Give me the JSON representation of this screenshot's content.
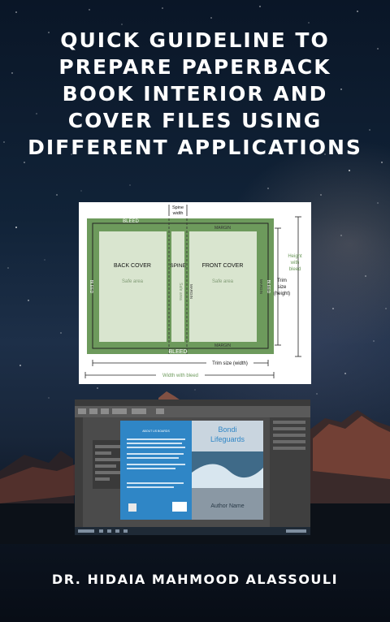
{
  "title": "QUICK GUIDELINE TO PREPARE PAPERBACK BOOK INTERIOR AND COVER FILES USING DIFFERENT APPLICATIONS",
  "author": "DR. HIDAIA MAHMOOD ALASSOULI",
  "diagram": {
    "bleed": "BLEED",
    "spine_width": "Spine\nwidth",
    "margin": "MARGIN",
    "back_cover": "BACK COVER",
    "spine": "SPINE",
    "front_cover": "FRONT COVER",
    "safe_area": "Safe area",
    "height_with_bleed": "Height\nwith\nbleed",
    "trim_size_height": "Trim\nsize\n(height)",
    "trim_size_width": "Trim size (width)",
    "width_with_bleed": "Width with bleed"
  },
  "screenshot": {
    "book_title": "Bondi\nLifeguards",
    "book_author": "Author Name",
    "back_heading": "ABOUT US BOARDS"
  },
  "colors": {
    "bleed_green": "#6d9a5c",
    "safe_area": "#d9e5cf",
    "back_cover_blue": "#2f86c6",
    "title_white": "#ffffff"
  }
}
